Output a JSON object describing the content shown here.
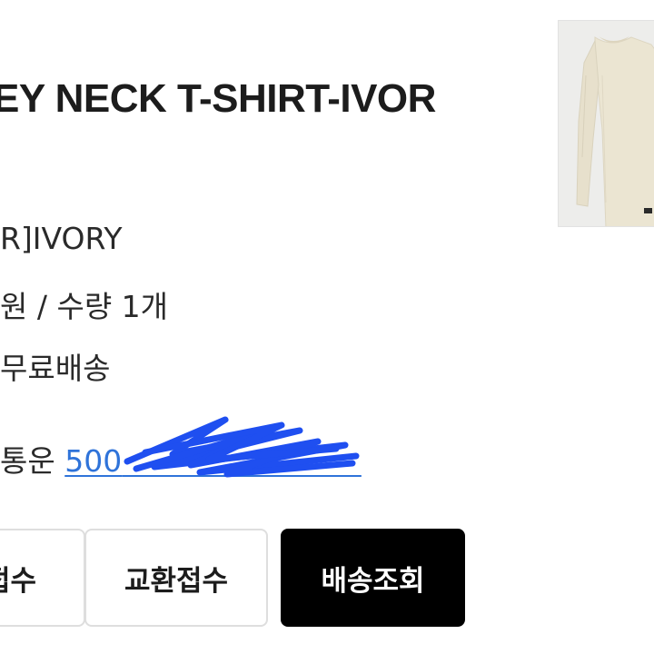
{
  "product": {
    "title": "EY NECK T-SHIRT-IVOR",
    "thumbnail_icon": "ivory-long-sleeve-tshirt-image"
  },
  "details": {
    "option": "R]IVORY",
    "price_quantity": "원 / 수량 1개",
    "shipping": "무료배송",
    "tracking_label": "통운",
    "tracking_number_visible": "500"
  },
  "redaction": {
    "color": "#1f4ff0"
  },
  "buttons": {
    "return": "접수",
    "exchange": "교환접수",
    "track_delivery": "배송조회"
  },
  "colors": {
    "link": "#2f73d9",
    "primary_button_bg": "#000000",
    "primary_button_text": "#ffffff"
  }
}
